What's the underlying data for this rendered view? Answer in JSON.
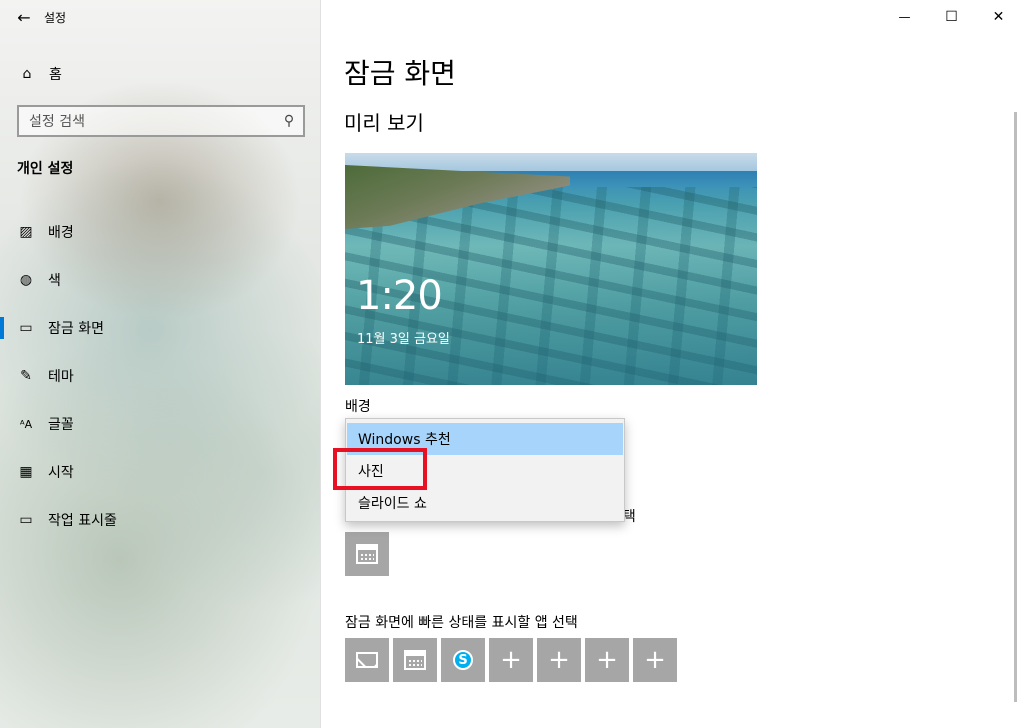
{
  "window": {
    "title": "설정",
    "back_glyph": "←",
    "minimize_glyph": "—",
    "maximize_glyph": "☐",
    "close_glyph": "✕"
  },
  "sidebar": {
    "home": {
      "label": "홈",
      "icon": "home-icon",
      "glyph": "⌂"
    },
    "search": {
      "placeholder": "설정 검색",
      "icon": "search-icon",
      "glyph": "⚲"
    },
    "section_title": "개인 설정",
    "items": [
      {
        "label": "배경",
        "icon": "image-icon",
        "glyph": "▨",
        "active": false
      },
      {
        "label": "색",
        "icon": "palette-icon",
        "glyph": "◍",
        "active": false
      },
      {
        "label": "잠금 화면",
        "icon": "lock-screen-icon",
        "glyph": "▭",
        "active": true
      },
      {
        "label": "테마",
        "icon": "theme-icon",
        "glyph": "✎",
        "active": false
      },
      {
        "label": "글꼴",
        "icon": "font-icon",
        "glyph": "ᴬA",
        "active": false
      },
      {
        "label": "시작",
        "icon": "start-icon",
        "glyph": "▦",
        "active": false
      },
      {
        "label": "작업 표시줄",
        "icon": "taskbar-icon",
        "glyph": "▭",
        "active": false
      }
    ]
  },
  "main": {
    "page_title": "잠금 화면",
    "preview_title": "미리 보기",
    "preview": {
      "time": "1:20",
      "date": "11월 3일 금요일"
    },
    "background_label": "배경",
    "background_dropdown": {
      "options": [
        "Windows 추천",
        "사진",
        "슬라이드 쇼"
      ],
      "selected_index": 0,
      "highlighted_option": "사진"
    },
    "detailed_status_label_partial": "선택",
    "quick_status_label": "잠금 화면에 빠른 상태를 표시할 앱 선택",
    "quick_status_apps": [
      {
        "icon": "mail-icon"
      },
      {
        "icon": "calendar-icon"
      },
      {
        "icon": "skype-icon",
        "glyph": "S"
      },
      {
        "icon": "plus-icon",
        "glyph": "+"
      },
      {
        "icon": "plus-icon",
        "glyph": "+"
      },
      {
        "icon": "plus-icon",
        "glyph": "+"
      },
      {
        "icon": "plus-icon",
        "glyph": "+"
      }
    ]
  }
}
